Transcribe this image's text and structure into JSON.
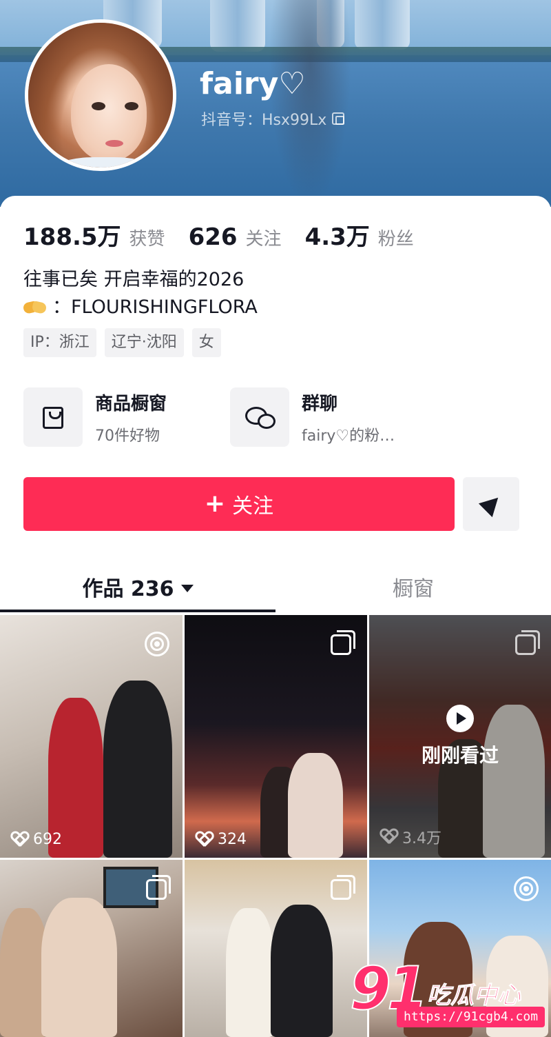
{
  "profile": {
    "username": "fairy♡",
    "douyin_id": "抖音号：Hsx99Lx",
    "stats": [
      {
        "num": "188.5万",
        "label": "获赞"
      },
      {
        "num": "626",
        "label": "关注"
      },
      {
        "num": "4.3万",
        "label": "粉丝"
      }
    ],
    "bio_line1": "往事已矣 开启幸福的2026",
    "bio_line2": "：FLOURISHINGFLORA",
    "tags": [
      "IP：浙江",
      "辽宁·沈阳",
      "女"
    ]
  },
  "shortcuts": [
    {
      "title": "商品橱窗",
      "subtitle": "70件好物",
      "icon": "shopping-bag-icon"
    },
    {
      "title": "群聊",
      "subtitle": "fairy♡的粉…",
      "icon": "chat-bubbles-icon"
    }
  ],
  "actions": {
    "follow_label": "关注",
    "share_icon": "send-icon"
  },
  "tabs": {
    "works": "作品 236",
    "shop": "橱窗"
  },
  "posts": [
    {
      "likes": "692",
      "badge": "live-photo-icon"
    },
    {
      "likes": "324",
      "badge": "multi-image-icon"
    },
    {
      "likes": "3.4万",
      "badge": "multi-image-icon",
      "overlay": "刚刚看过"
    },
    {
      "likes": "",
      "badge": "multi-image-icon"
    },
    {
      "likes": "",
      "badge": "multi-image-icon"
    },
    {
      "likes": "",
      "badge": "live-photo-icon"
    }
  ],
  "watermark": {
    "logo": "91",
    "name": "吃瓜中心",
    "url": "https://91cgb4.com"
  },
  "colors": {
    "accent": "#fe2c55",
    "text": "#161823",
    "muted": "#8a8b91"
  }
}
